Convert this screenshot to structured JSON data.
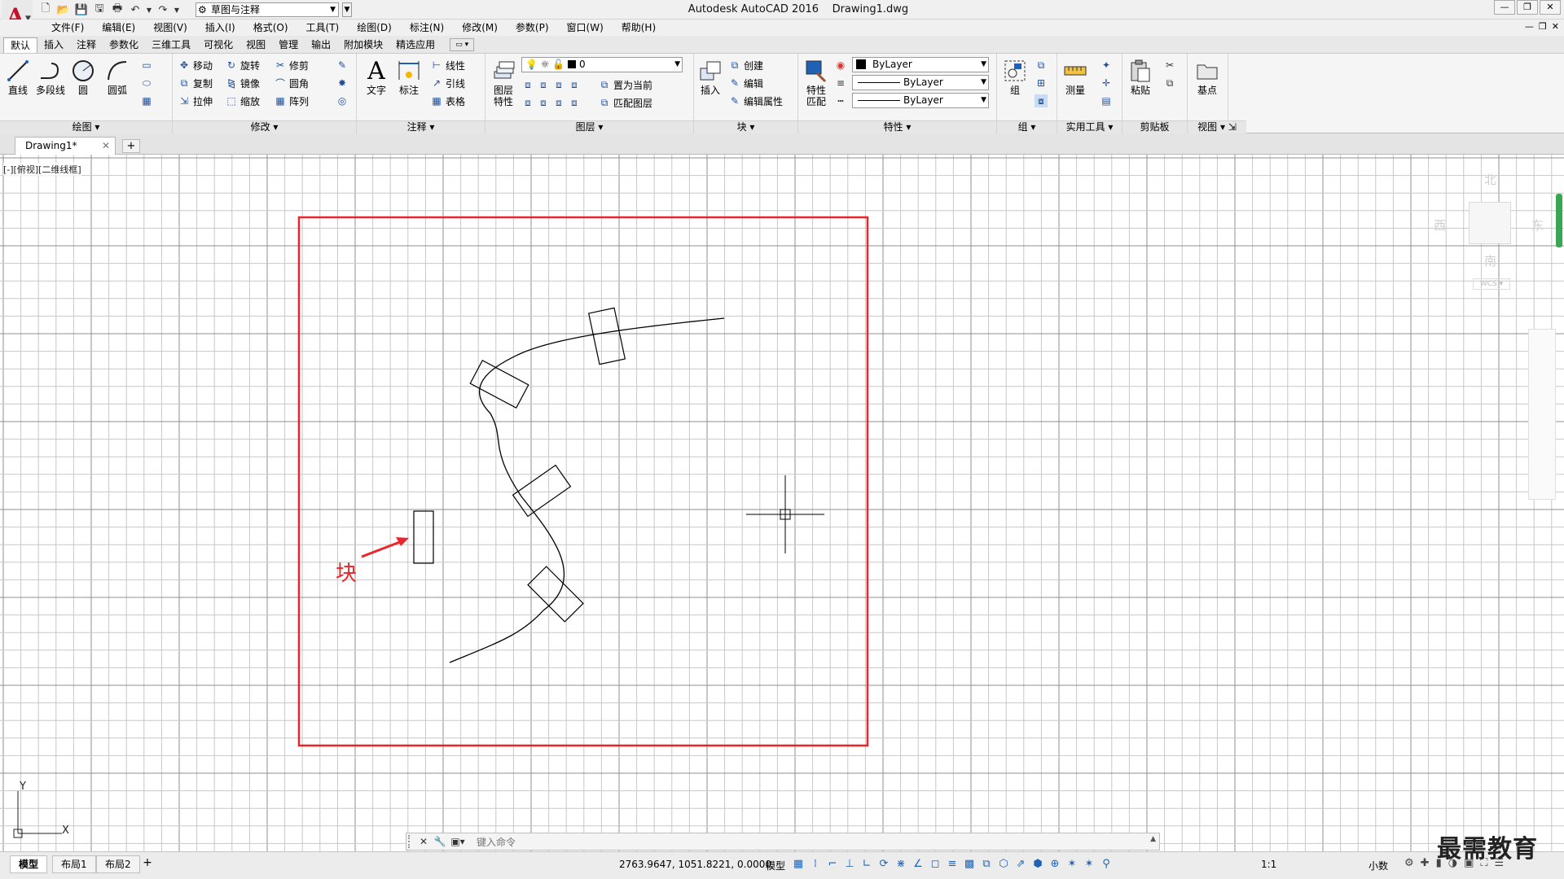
{
  "titlebar": {
    "app_title": "Autodesk AutoCAD 2016",
    "file_name": "Drawing1.dwg",
    "workspace": "草图与注释"
  },
  "menubar": {
    "items": [
      "文件(F)",
      "编辑(E)",
      "视图(V)",
      "插入(I)",
      "格式(O)",
      "工具(T)",
      "绘图(D)",
      "标注(N)",
      "修改(M)",
      "参数(P)",
      "窗口(W)",
      "帮助(H)"
    ]
  },
  "ribbon_tabs": [
    "默认",
    "插入",
    "注释",
    "参数化",
    "三维工具",
    "可视化",
    "视图",
    "管理",
    "输出",
    "附加模块",
    "精选应用"
  ],
  "ribbon": {
    "draw": {
      "title": "绘图",
      "line": "直线",
      "polyline": "多段线",
      "circle": "圆",
      "arc": "圆弧"
    },
    "modify": {
      "title": "修改",
      "move": "移动",
      "rotate": "旋转",
      "trim": "修剪",
      "copy": "复制",
      "mirror": "镜像",
      "fillet": "圆角",
      "stretch": "拉伸",
      "scale": "缩放",
      "array": "阵列"
    },
    "annotation": {
      "title": "注释",
      "text": "文字",
      "dimension": "标注",
      "linear": "线性",
      "leader": "引线",
      "table": "表格"
    },
    "layers": {
      "title": "图层",
      "properties": "图层特性",
      "properties_1": "图层",
      "properties_2": "特性",
      "current_layer": "0",
      "make_current": "置为当前",
      "match_layer": "匹配图层"
    },
    "block": {
      "title": "块",
      "insert": "插入",
      "create": "创建",
      "edit": "编辑",
      "edit_attr": "编辑属性"
    },
    "properties": {
      "title": "特性",
      "match": "特性匹配",
      "match_1": "特性",
      "match_2": "匹配",
      "color": "ByLayer",
      "linetype": "ByLayer",
      "lineweight": "ByLayer"
    },
    "groups": {
      "title": "组",
      "group": "组"
    },
    "utilities": {
      "title": "实用工具",
      "measure": "测量"
    },
    "clipboard": {
      "title": "剪贴板",
      "paste": "粘贴"
    },
    "view": {
      "title": "视图",
      "base": "基点"
    }
  },
  "doc_tab": {
    "name": "Drawing1*"
  },
  "canvas": {
    "viewport_label": "[-][俯视][二维线框]",
    "annotation_label": "块",
    "viewcube": {
      "north": "北",
      "south": "南",
      "east": "东",
      "west": "西",
      "wcs": "WCS"
    },
    "ucs": {
      "x": "X",
      "y": "Y"
    },
    "colors": {
      "grid": "#c8c8c8",
      "grid_major": "#8f8f8f",
      "highlight_box": "#e8262b",
      "geometry": "#000000"
    }
  },
  "cmdline": {
    "placeholder": "键入命令"
  },
  "statusbar": {
    "layouts": [
      "模型",
      "布局1",
      "布局2"
    ],
    "coords": "2763.9647, 1051.8221, 0.0000",
    "model": "模型",
    "scale": "1:1",
    "units": "小数"
  },
  "watermark": "最需教育"
}
